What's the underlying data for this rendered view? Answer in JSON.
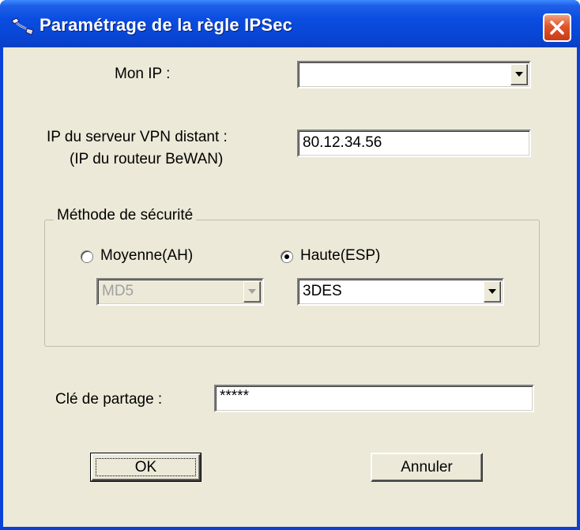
{
  "window": {
    "title": "Paramétrage de la règle IPSec",
    "titlebar_color": "#0a4de0",
    "close_color": "#e0542c",
    "icon": "network-cable-icon"
  },
  "form": {
    "mon_ip_label": "Mon IP :",
    "mon_ip_value": "",
    "remote_ip_label": "IP du serveur VPN distant :",
    "remote_ip_sublabel": "(IP du routeur BeWAN)",
    "remote_ip_value": "80.12.34.56",
    "security": {
      "legend": "Méthode de sécurité",
      "option_ah_label": "Moyenne(AH)",
      "option_esp_label": "Haute(ESP)",
      "selected": "Haute(ESP)",
      "ah_algorithm": "MD5",
      "esp_algorithm": "3DES"
    },
    "shared_key_label": "Clé de partage :",
    "shared_key_value": "*****"
  },
  "buttons": {
    "ok": "OK",
    "cancel": "Annuler"
  }
}
